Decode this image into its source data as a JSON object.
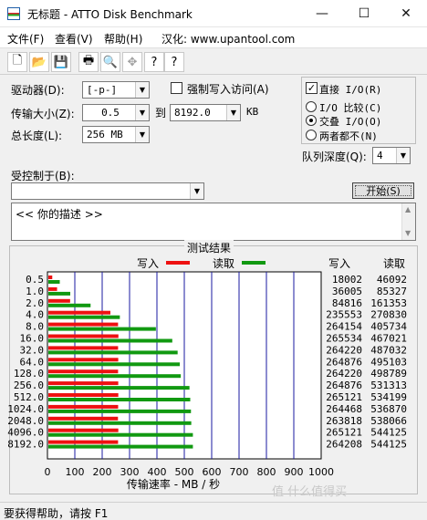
{
  "window": {
    "title": "无标题 - ATTO Disk Benchmark",
    "minimize": "—",
    "maximize": "☐",
    "close": "✕"
  },
  "menu": [
    "文件(F)",
    "查看(V)",
    "帮助(H)",
    "汉化: www.upantool.com"
  ],
  "toolbar": {
    "new": "🗋",
    "open": "📂",
    "save": "💾",
    "print": "🖶",
    "preview": "🔍",
    "move": "✥",
    "help": "?"
  },
  "form": {
    "drive_label": "驱动器(D):",
    "drive_value": "[-p-]",
    "force_write_label": "强制写入访问(A)",
    "transfer_label": "传输大小(Z):",
    "transfer_from": "0.5",
    "to_label": "到",
    "transfer_to": "8192.0",
    "kb_label": "KB",
    "total_length_label": "总长度(L):",
    "total_length_value": "256 MB",
    "direct_io_label": "直接 I/O(R)",
    "io_compare_label": "I/O 比较(C)",
    "overlap_io_label": "交叠 I/O(O)",
    "neither_label": "两者都不(N)",
    "queue_depth_label": "队列深度(Q):",
    "queue_depth_value": "4",
    "controlled_by_label": "受控制于(B):",
    "controlled_by_value": "",
    "start_button": "开始(S)",
    "description": "<<  你的描述  >>"
  },
  "results": {
    "title": "测试结果",
    "legend_write": "写入",
    "legend_read": "读取",
    "col_write": "写入",
    "col_read": "读取"
  },
  "chart_data": {
    "type": "bar",
    "orientation": "horizontal",
    "categories": [
      "0.5",
      "1.0",
      "2.0",
      "4.0",
      "8.0",
      "16.0",
      "32.0",
      "64.0",
      "128.0",
      "256.0",
      "512.0",
      "1024.0",
      "2048.0",
      "4096.0",
      "8192.0"
    ],
    "series": [
      {
        "name": "写入",
        "color": "#ee1111",
        "values": [
          18002,
          36005,
          84816,
          235553,
          264154,
          265534,
          264220,
          264876,
          264220,
          264876,
          265121,
          264468,
          263818,
          265121,
          264208
        ]
      },
      {
        "name": "读取",
        "color": "#119911",
        "values": [
          46092,
          85327,
          161353,
          270830,
          405734,
          467021,
          487032,
          495103,
          498789,
          531313,
          534199,
          536870,
          538066,
          544125,
          544125
        ]
      }
    ],
    "xlabel": "传输速率 - MB / 秒",
    "xlim": [
      0,
      1000
    ],
    "xticks": [
      "0",
      "100",
      "200",
      "300",
      "400",
      "500",
      "600",
      "700",
      "800",
      "900",
      "1000"
    ]
  },
  "status": "要获得帮助，请按 F1",
  "watermark": "值 什么值得买"
}
